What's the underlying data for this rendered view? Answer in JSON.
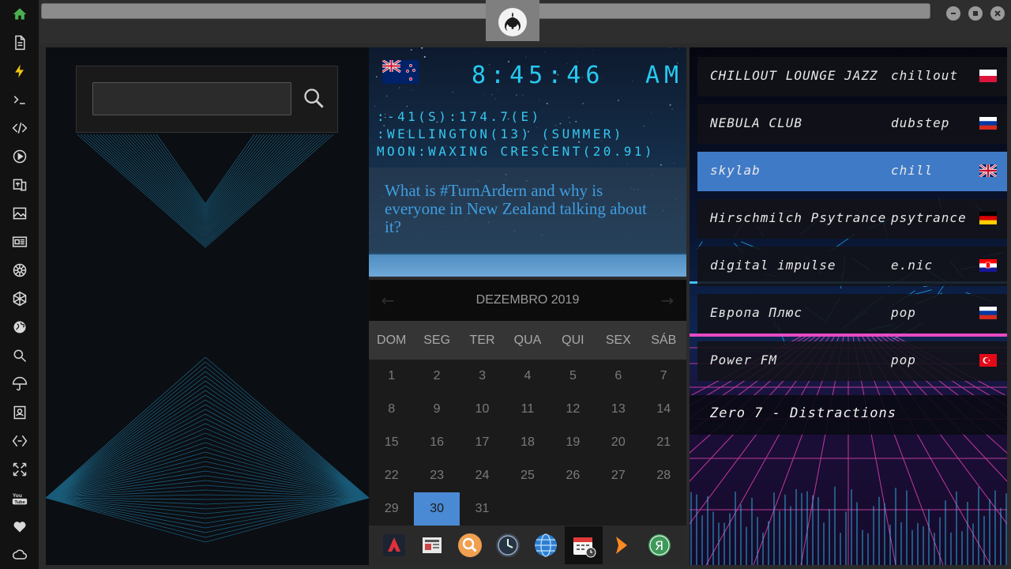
{
  "sidebar": {
    "icons": [
      "home-icon",
      "document-icon",
      "flash-icon",
      "terminal-icon",
      "code-icon",
      "play-icon",
      "translate-icon",
      "image-icon",
      "news-icon",
      "galactic-empire-icon",
      "hexagon-icon",
      "globe-icon",
      "search-icon",
      "umbrella-icon",
      "contacts-icon",
      "network-icon",
      "expand-icon",
      "youtube-icon",
      "heart-icon",
      "cloud-icon"
    ],
    "active_color": "#4caf50"
  },
  "topbar": {
    "logo": "rebel-alliance-icon"
  },
  "search": {
    "value": "",
    "placeholder": ""
  },
  "clock": {
    "flag": "new-zealand-flag",
    "time": "8:45:46",
    "ampm": "AM",
    "coords": ":-41(S):174.7(E)",
    "location": ":WELLINGTON(13) (SUMMER)",
    "moon": "MOON:WAXING CRESCENT(20.91)",
    "digital_color": "#27c9f0"
  },
  "news": {
    "headline": "What is #TurnArdern and why is everyone in New Zealand talking about it?"
  },
  "calendar": {
    "title": "DEZEMBRO 2019",
    "weekdays": [
      "DOM",
      "SEG",
      "TER",
      "QUA",
      "QUI",
      "SEX",
      "SÁB"
    ],
    "weeks": [
      [
        "1",
        "2",
        "3",
        "4",
        "5",
        "6",
        "7"
      ],
      [
        "8",
        "9",
        "10",
        "11",
        "12",
        "13",
        "14"
      ],
      [
        "15",
        "16",
        "17",
        "18",
        "19",
        "20",
        "21"
      ],
      [
        "22",
        "23",
        "24",
        "25",
        "26",
        "27",
        "28"
      ],
      [
        "29",
        "30",
        "31",
        "",
        "",
        "",
        ""
      ]
    ],
    "selected_day": "30",
    "selected_color": "#4a8ad4"
  },
  "dock": {
    "items": [
      "rocket-icon",
      "newspaper-icon",
      "search-icon",
      "clock-icon",
      "globe-icon",
      "calendar-icon",
      "play-arrow-icon",
      "yandex-icon"
    ],
    "active": "calendar-icon"
  },
  "radio": {
    "stations": [
      {
        "name": "CHILLOUT LOUNGE JAZZ",
        "genre": "chillout",
        "flag": "poland-flag"
      },
      {
        "name": "NEBULA CLUB",
        "genre": "dubstep",
        "flag": "russia-flag"
      },
      {
        "name": "skylab",
        "genre": "chill",
        "flag": "uk-flag"
      },
      {
        "name": "Hirschmilch Psytrance",
        "genre": "psytrance",
        "flag": "germany-flag"
      },
      {
        "name": "digital impulse",
        "genre": "e.nic",
        "flag": "croatia-flag"
      },
      {
        "name": "Европа Плюс",
        "genre": "pop",
        "flag": "russia-flag"
      },
      {
        "name": "Power FM",
        "genre": "pop",
        "flag": "turkey-flag"
      }
    ],
    "selected_index": 2,
    "now_playing": "Zero 7 - Distractions",
    "accent": "#3f7ac7"
  }
}
